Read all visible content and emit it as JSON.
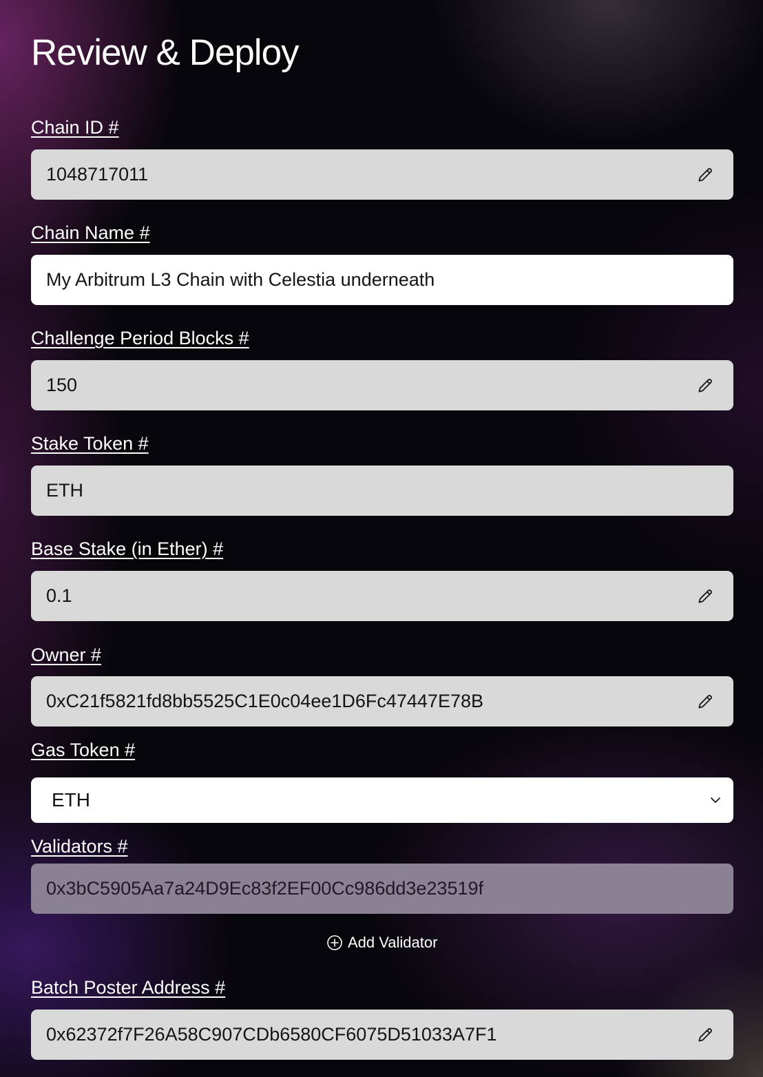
{
  "page": {
    "title": "Review & Deploy"
  },
  "fields": {
    "chain_id": {
      "label": "Chain ID #",
      "value": "1048717011"
    },
    "chain_name": {
      "label": "Chain Name #",
      "value": "My Arbitrum L3 Chain with Celestia underneath"
    },
    "challenge_period": {
      "label": "Challenge Period Blocks #",
      "value": "150"
    },
    "stake_token": {
      "label": "Stake Token #",
      "value": "ETH"
    },
    "base_stake": {
      "label": "Base Stake (in Ether) #",
      "value": "0.1"
    },
    "owner": {
      "label": "Owner #",
      "value": "0xC21f5821fd8bb5525C1E0c04ee1D6Fc47447E78B"
    },
    "gas_token": {
      "label": "Gas Token #",
      "selected": "ETH"
    },
    "validators": {
      "label": "Validators #",
      "value": "0x3bC5905Aa7a24D9Ec83f2EF00Cc986dd3e23519f"
    },
    "batch_poster": {
      "label": "Batch Poster Address #",
      "value": "0x62372f7F26A58C907CDb6580CF6075D51033A7F1"
    }
  },
  "actions": {
    "add_validator_label": "Add Validator"
  },
  "icons": {
    "edit": "pencil-icon",
    "dropdown": "chevron-down-icon",
    "add": "plus-circle-icon"
  }
}
